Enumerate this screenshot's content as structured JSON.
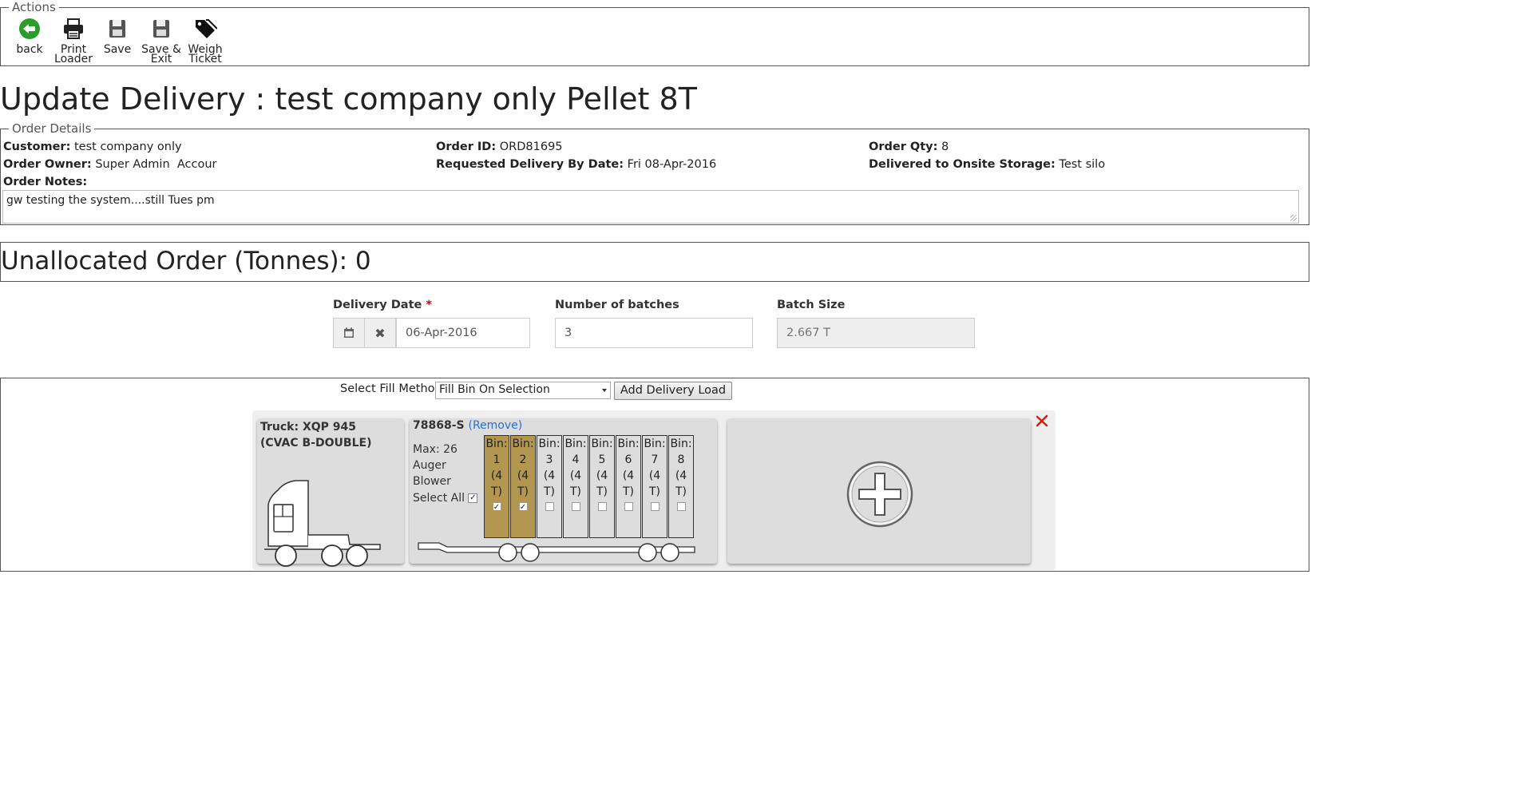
{
  "actions": {
    "legend": "Actions",
    "buttons": [
      {
        "line1": "back",
        "line2": ""
      },
      {
        "line1": "Print",
        "line2": "Loader"
      },
      {
        "line1": "Save",
        "line2": ""
      },
      {
        "line1": "Save &",
        "line2": "Exit"
      },
      {
        "line1": "Weigh",
        "line2": "Ticket"
      }
    ]
  },
  "title": "Update Delivery : test company only Pellet 8T",
  "order": {
    "legend": "Order Details",
    "customer_label": "Customer:",
    "customer": "test company only",
    "owner_label": "Order Owner:",
    "owner": "Super Admin  Accour",
    "notes_label": "Order Notes:",
    "id_label": "Order ID:",
    "id": "ORD81695",
    "req_label": "Requested Delivery By Date:",
    "req_date": "Fri 08-Apr-2016",
    "qty_label": "Order Qty:",
    "qty": "8",
    "storage_label": "Delivered to Onsite Storage:",
    "storage": "Test silo",
    "notes": "gw testing the system....still Tues pm"
  },
  "unallocated": "Unallocated Order (Tonnes): 0",
  "form": {
    "delivery_date_label": "Delivery Date",
    "required_mark": "*",
    "delivery_date": "06-Apr-2016",
    "batches_label": "Number of batches",
    "batches": "3",
    "batch_size_label": "Batch Size",
    "batch_size": "2.667 T"
  },
  "load": {
    "fill_label": "Select Fill Method",
    "fill_value": "Fill Bin On Selection",
    "add_button": "Add Delivery Load",
    "truck": "Truck: XQP 945 (CVAC B-DOUBLE)",
    "trailer": "78868-S",
    "remove": "(Remove)",
    "max": "Max: 26",
    "auger": "Auger",
    "blower": "Blower",
    "select_all": "Select All",
    "check_mark": "✓",
    "bins": [
      {
        "l1": "Bin:",
        "l2": "1",
        "l3": "(4 T)"
      },
      {
        "l1": "Bin:",
        "l2": "2",
        "l3": "(4 T)"
      },
      {
        "l1": "Bin:",
        "l2": "3",
        "l3": "(4 T)"
      },
      {
        "l1": "Bin:",
        "l2": "4",
        "l3": "(4 T)"
      },
      {
        "l1": "Bin:",
        "l2": "5",
        "l3": "(4 T)"
      },
      {
        "l1": "Bin:",
        "l2": "6",
        "l3": "(4 T)"
      },
      {
        "l1": "Bin:",
        "l2": "7",
        "l3": "(4 T)"
      },
      {
        "l1": "Bin:",
        "l2": "8",
        "l3": "(4 T)"
      }
    ],
    "bin_checked": [
      true,
      true,
      false,
      false,
      false,
      false,
      false,
      false
    ],
    "filled_color": "#b39650"
  }
}
